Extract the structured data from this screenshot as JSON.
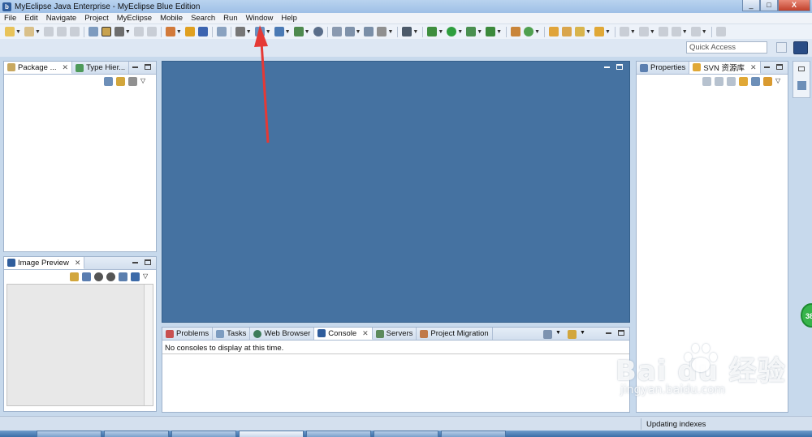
{
  "window": {
    "title": "MyEclipse Java Enterprise - MyEclipse Blue Edition",
    "app_badge": "b"
  },
  "window_buttons": {
    "minimize": "_",
    "maximize": "□",
    "close": "X"
  },
  "menu": [
    "File",
    "Edit",
    "Navigate",
    "Project",
    "MyEclipse",
    "Mobile",
    "Search",
    "Run",
    "Window",
    "Help"
  ],
  "quick_access": {
    "placeholder": "Quick Access"
  },
  "package_panel": {
    "tabs": [
      {
        "label": "Package ...",
        "icon": "package-explorer-icon"
      },
      {
        "label": "Type Hier...",
        "icon": "type-hierarchy-icon"
      }
    ]
  },
  "image_preview_panel": {
    "tabs": [
      {
        "label": "Image Preview",
        "icon": "image-icon"
      }
    ]
  },
  "right_panel": {
    "tabs": [
      {
        "label": "Properties",
        "icon": "properties-icon"
      },
      {
        "label": "SVN 资源库",
        "icon": "svn-repository-icon"
      }
    ]
  },
  "bottom_panel": {
    "tabs": [
      {
        "label": "Problems",
        "icon": "problems-icon",
        "active": false
      },
      {
        "label": "Tasks",
        "icon": "tasks-icon",
        "active": false
      },
      {
        "label": "Web Browser",
        "icon": "globe-icon",
        "active": false
      },
      {
        "label": "Console",
        "icon": "console-icon",
        "active": true
      },
      {
        "label": "Servers",
        "icon": "servers-icon",
        "active": false
      },
      {
        "label": "Project Migration",
        "icon": "migration-icon",
        "active": false
      }
    ],
    "console_message": "No consoles to display at this time."
  },
  "status": {
    "text": "Updating indexes"
  },
  "side_badge": "38",
  "watermark": {
    "main": "Bai du 经验",
    "sub": "jingyan.baidu.com"
  },
  "colors": {
    "editor_bg": "#4572a1",
    "arrow": "#e53935",
    "accent": "#2a4d86"
  }
}
